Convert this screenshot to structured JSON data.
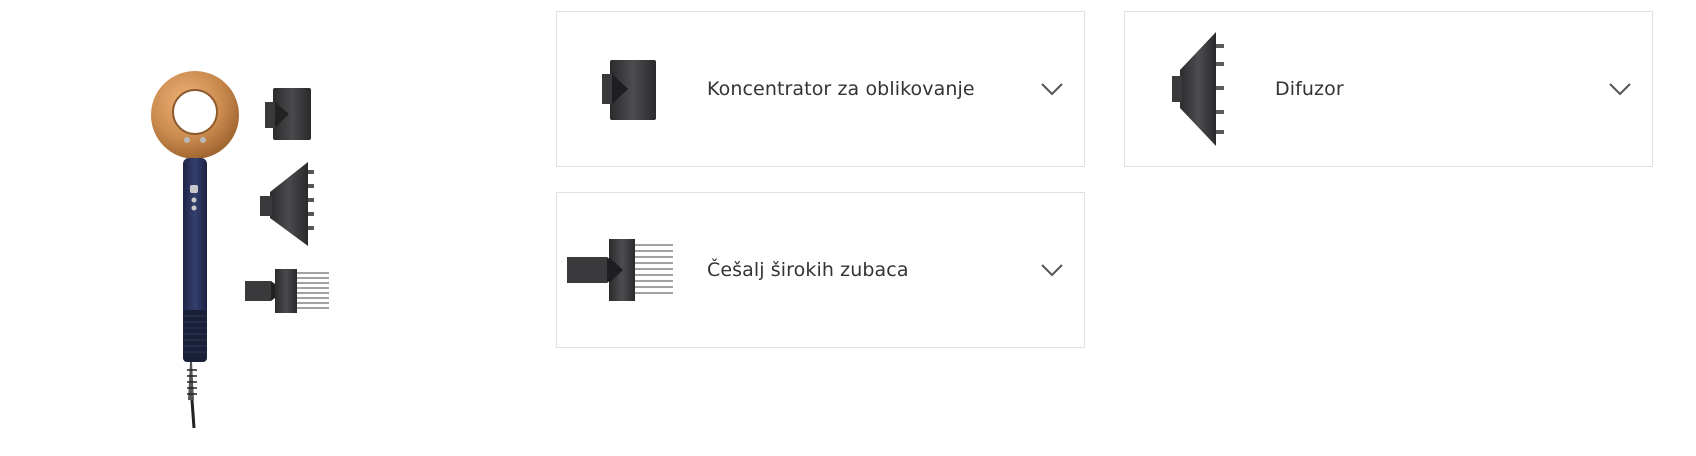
{
  "product": {
    "icon": "hair-dryer-with-attachments-image",
    "colors": {
      "copper": "#c98a4e",
      "navy": "#26305a",
      "attachment_grey": "#3a3a3c"
    }
  },
  "accessories": [
    {
      "label": "Koncentrator za oblikovanje",
      "icon": "styling-concentrator-image",
      "chevron": "chevron-down-icon"
    },
    {
      "label": "Difuzor",
      "icon": "diffuser-image",
      "chevron": "chevron-down-icon"
    },
    {
      "label": "Češalj širokih zubaca",
      "icon": "wide-tooth-comb-image",
      "chevron": "chevron-down-icon"
    }
  ],
  "colors": {
    "card_border": "#e1e1e1",
    "text": "#333333",
    "chevron": "#555555"
  }
}
